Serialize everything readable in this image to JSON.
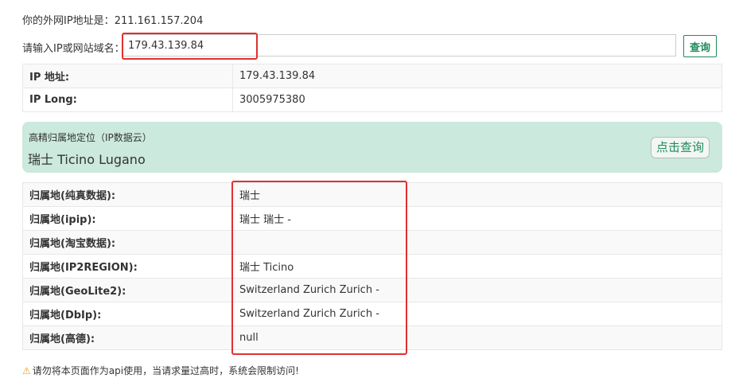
{
  "header": {
    "my_ip_label": "你的外网IP地址是：",
    "my_ip_value": "211.161.157.204"
  },
  "query": {
    "label": "请输入IP或网站域名：",
    "value": "179.43.139.84",
    "button": "查询"
  },
  "ip_table": [
    {
      "key": "IP 地址:",
      "value": "179.43.139.84"
    },
    {
      "key": "IP Long:",
      "value": "3005975380"
    }
  ],
  "accurate": {
    "title": "高精归属地定位（IP数据云）",
    "value": "瑞士 Ticino Lugano",
    "button": "点击查询"
  },
  "location_table": [
    {
      "key": "归属地(纯真数据):",
      "value": "瑞士"
    },
    {
      "key": "归属地(ipip):",
      "value": "瑞士 瑞士 -"
    },
    {
      "key": "归属地(淘宝数据):",
      "value": ""
    },
    {
      "key": "归属地(IP2REGION):",
      "value": "瑞士 Ticino"
    },
    {
      "key": "归属地(GeoLite2):",
      "value": "Switzerland Zurich Zurich -"
    },
    {
      "key": "归属地(DbIp):",
      "value": "Switzerland Zurich Zurich -"
    },
    {
      "key": "归属地(高德):",
      "value": "null"
    }
  ],
  "warning": {
    "icon": "warning-icon",
    "text": "请勿将本页面作为api使用，当请求量过高时，系统会限制访问!"
  },
  "colors": {
    "accent": "#1f8b5a",
    "highlight": "#e0312f",
    "accurate_bg": "#cbe9dc"
  }
}
